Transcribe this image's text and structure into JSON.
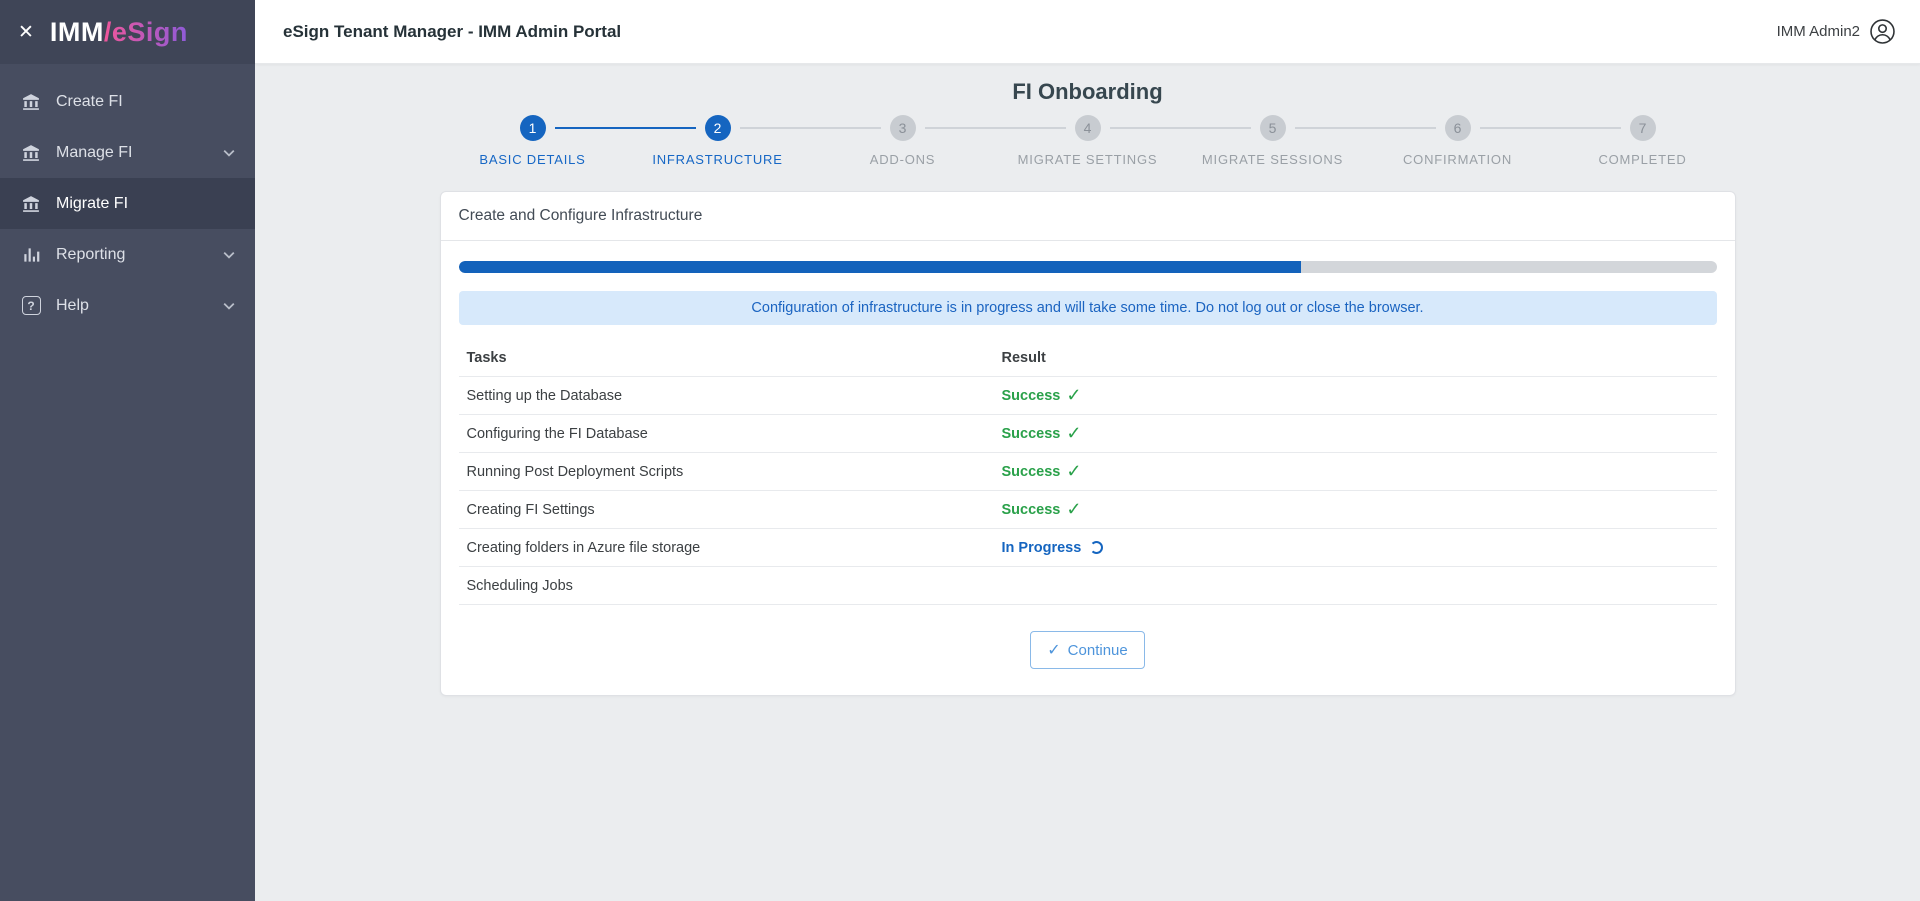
{
  "icons": {
    "close": "✕",
    "help": "?",
    "check": "✓"
  },
  "sidebar": {
    "logo": {
      "prefix": "IMM",
      "suffix": "/eSign"
    },
    "items": [
      {
        "label": "Create FI"
      },
      {
        "label": "Manage FI"
      },
      {
        "label": "Migrate FI"
      },
      {
        "label": "Reporting"
      },
      {
        "label": "Help"
      }
    ]
  },
  "header": {
    "title": "eSign Tenant Manager - IMM Admin Portal",
    "user": "IMM Admin2"
  },
  "page": {
    "title": "FI Onboarding"
  },
  "stepper": {
    "steps": [
      {
        "number": "1",
        "label": "BASIC DETAILS",
        "state": "completed"
      },
      {
        "number": "2",
        "label": "INFRASTRUCTURE",
        "state": "active"
      },
      {
        "number": "3",
        "label": "ADD-ONS",
        "state": "upcoming"
      },
      {
        "number": "4",
        "label": "MIGRATE SETTINGS",
        "state": "upcoming"
      },
      {
        "number": "5",
        "label": "MIGRATE SESSIONS",
        "state": "upcoming"
      },
      {
        "number": "6",
        "label": "CONFIRMATION",
        "state": "upcoming"
      },
      {
        "number": "7",
        "label": "COMPLETED",
        "state": "upcoming"
      }
    ]
  },
  "card": {
    "title": "Create and Configure Infrastructure",
    "progress_percent": 67,
    "banner": "Configuration of infrastructure is in progress and will take some time. Do not log out or close the browser.",
    "table": {
      "headers": [
        "Tasks",
        "Result"
      ],
      "rows": [
        {
          "task": "Setting up the Database",
          "result": "Success",
          "status": "success"
        },
        {
          "task": "Configuring the FI Database",
          "result": "Success",
          "status": "success"
        },
        {
          "task": "Running Post Deployment Scripts",
          "result": "Success",
          "status": "success"
        },
        {
          "task": "Creating FI Settings",
          "result": "Success",
          "status": "success"
        },
        {
          "task": "Creating folders in Azure file storage",
          "result": "In Progress",
          "status": "in-progress"
        },
        {
          "task": "Scheduling Jobs",
          "result": "",
          "status": "pending"
        }
      ]
    },
    "continue_label": "Continue"
  },
  "colors": {
    "accent_blue": "#1565c0",
    "success_green": "#2aa14a",
    "banner_bg": "#d7e9fb",
    "sidebar_bg": "#474d60",
    "logo_gradient_start": "#f0569b",
    "logo_gradient_end": "#8e5bd8"
  }
}
